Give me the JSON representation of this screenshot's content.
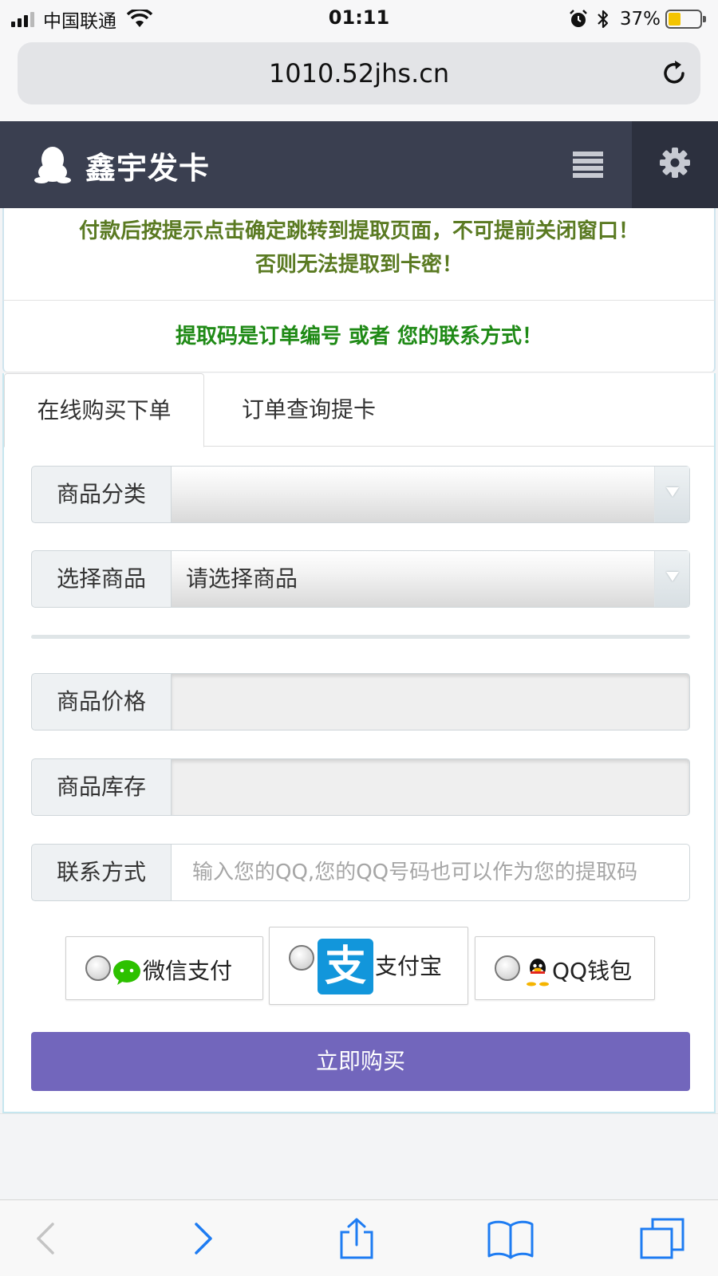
{
  "status_bar": {
    "carrier": "中国联通",
    "time": "01:11",
    "battery_percent": "37%"
  },
  "browser": {
    "url": "1010.52jhs.cn"
  },
  "header": {
    "brand": "鑫宇发卡"
  },
  "notices": {
    "line1": "付款后按提示点击确定跳转到提取页面，不可提前关闭窗口！",
    "line2": "否则无法提取到卡密！",
    "extract_code": "提取码是订单编号 或者 您的联系方式！"
  },
  "tabs": [
    {
      "label": "在线购买下单",
      "active": true
    },
    {
      "label": "订单查询提卡",
      "active": false
    }
  ],
  "form": {
    "category": {
      "label": "商品分类",
      "value": ""
    },
    "product": {
      "label": "选择商品",
      "value": "请选择商品"
    },
    "price": {
      "label": "商品价格",
      "value": ""
    },
    "stock": {
      "label": "商品库存",
      "value": ""
    },
    "contact": {
      "label": "联系方式",
      "placeholder": "输入您的QQ,您的QQ号码也可以作为您的提取码"
    }
  },
  "payment": {
    "wechat": "微信支付",
    "alipay": "支付宝",
    "alipay_glyph": "支",
    "qq": "QQ钱包"
  },
  "buy_button": "立即购买",
  "colors": {
    "header_bg": "#3a3f50",
    "notice_olive": "#5a7a22",
    "notice_green": "#1f8a16",
    "buy_button": "#7266bc",
    "ios_blue": "#1e7cf2"
  }
}
